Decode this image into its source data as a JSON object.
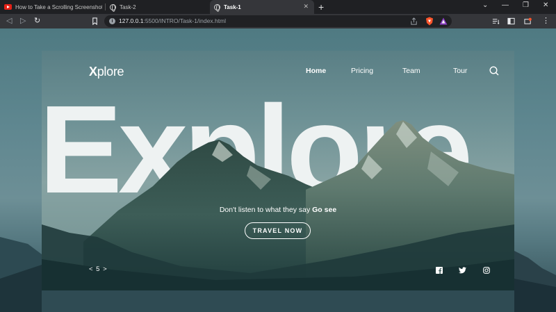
{
  "browser": {
    "tabs": [
      {
        "title": "How to Take a Scrolling Screenshot in",
        "icon": "youtube-icon",
        "active": false
      },
      {
        "title": "Task-2",
        "icon": "globe-icon",
        "active": false
      },
      {
        "title": "Task-1",
        "icon": "globe-icon",
        "active": true
      }
    ],
    "new_tab": "+",
    "url_host": "127.0.0.1",
    "url_rest": ":5500/INTRO/Task-1/index.html",
    "colors": {
      "frame": "#1f2023",
      "toolbar": "#35363a",
      "omnibox": "#202124",
      "brave": "#fb542b"
    }
  },
  "site": {
    "logo_x": "X",
    "logo_rest": "plore",
    "nav": [
      {
        "label": "Home",
        "active": true
      },
      {
        "label": "Pricing",
        "active": false
      },
      {
        "label": "Team",
        "active": false
      },
      {
        "label": "Tour",
        "active": false
      }
    ],
    "hero_word": "Explore",
    "tagline_lead": "Don't listen to what they say",
    "tagline_bold": "Go see",
    "cta_label": "TRAVEL NOW",
    "pager": "< 5 >",
    "social": [
      "facebook-icon",
      "twitter-icon",
      "instagram-icon"
    ],
    "colors": {
      "hero_text": "#eef2f2",
      "accent_white": "#ffffff"
    }
  }
}
